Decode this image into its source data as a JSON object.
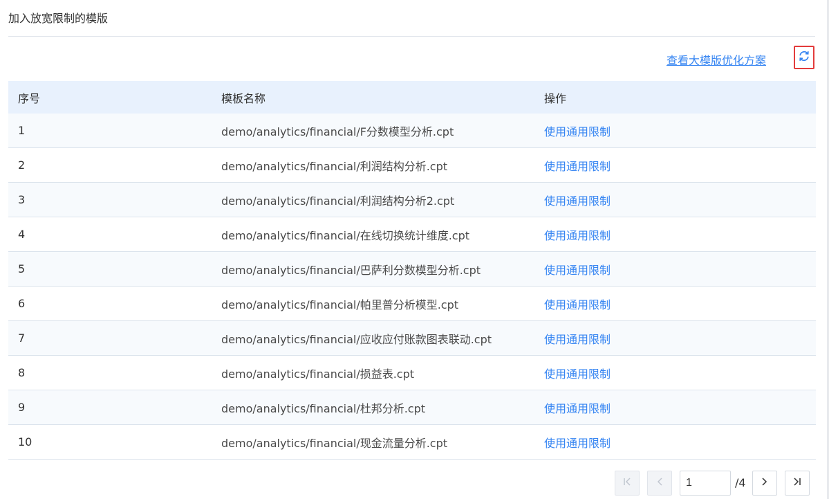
{
  "header": {
    "title": "加入放宽限制的模版",
    "optimize_link": "查看大模版优化方案",
    "refresh_icon": "refresh-icon"
  },
  "table": {
    "columns": [
      "序号",
      "模板名称",
      "操作"
    ],
    "rows": [
      {
        "index": "1",
        "name": "demo/analytics/financial/F分数模型分析.cpt",
        "action": "使用通用限制"
      },
      {
        "index": "2",
        "name": "demo/analytics/financial/利润结构分析.cpt",
        "action": "使用通用限制"
      },
      {
        "index": "3",
        "name": "demo/analytics/financial/利润结构分析2.cpt",
        "action": "使用通用限制"
      },
      {
        "index": "4",
        "name": "demo/analytics/financial/在线切换统计维度.cpt",
        "action": "使用通用限制"
      },
      {
        "index": "5",
        "name": "demo/analytics/financial/巴萨利分数模型分析.cpt",
        "action": "使用通用限制"
      },
      {
        "index": "6",
        "name": "demo/analytics/financial/帕里普分析模型.cpt",
        "action": "使用通用限制"
      },
      {
        "index": "7",
        "name": "demo/analytics/financial/应收应付账款图表联动.cpt",
        "action": "使用通用限制"
      },
      {
        "index": "8",
        "name": "demo/analytics/financial/损益表.cpt",
        "action": "使用通用限制"
      },
      {
        "index": "9",
        "name": "demo/analytics/financial/杜邦分析.cpt",
        "action": "使用通用限制"
      },
      {
        "index": "10",
        "name": "demo/analytics/financial/现金流量分析.cpt",
        "action": "使用通用限制"
      }
    ]
  },
  "pagination": {
    "current_page": "1",
    "total_label": "/4",
    "first_icon": "first-page-icon",
    "prev_icon": "prev-page-icon",
    "next_icon": "next-page-icon",
    "last_icon": "last-page-icon"
  },
  "colors": {
    "accent": "#3685f2",
    "header_bg": "#e8f1fd",
    "highlight_border": "#e33b3b"
  }
}
